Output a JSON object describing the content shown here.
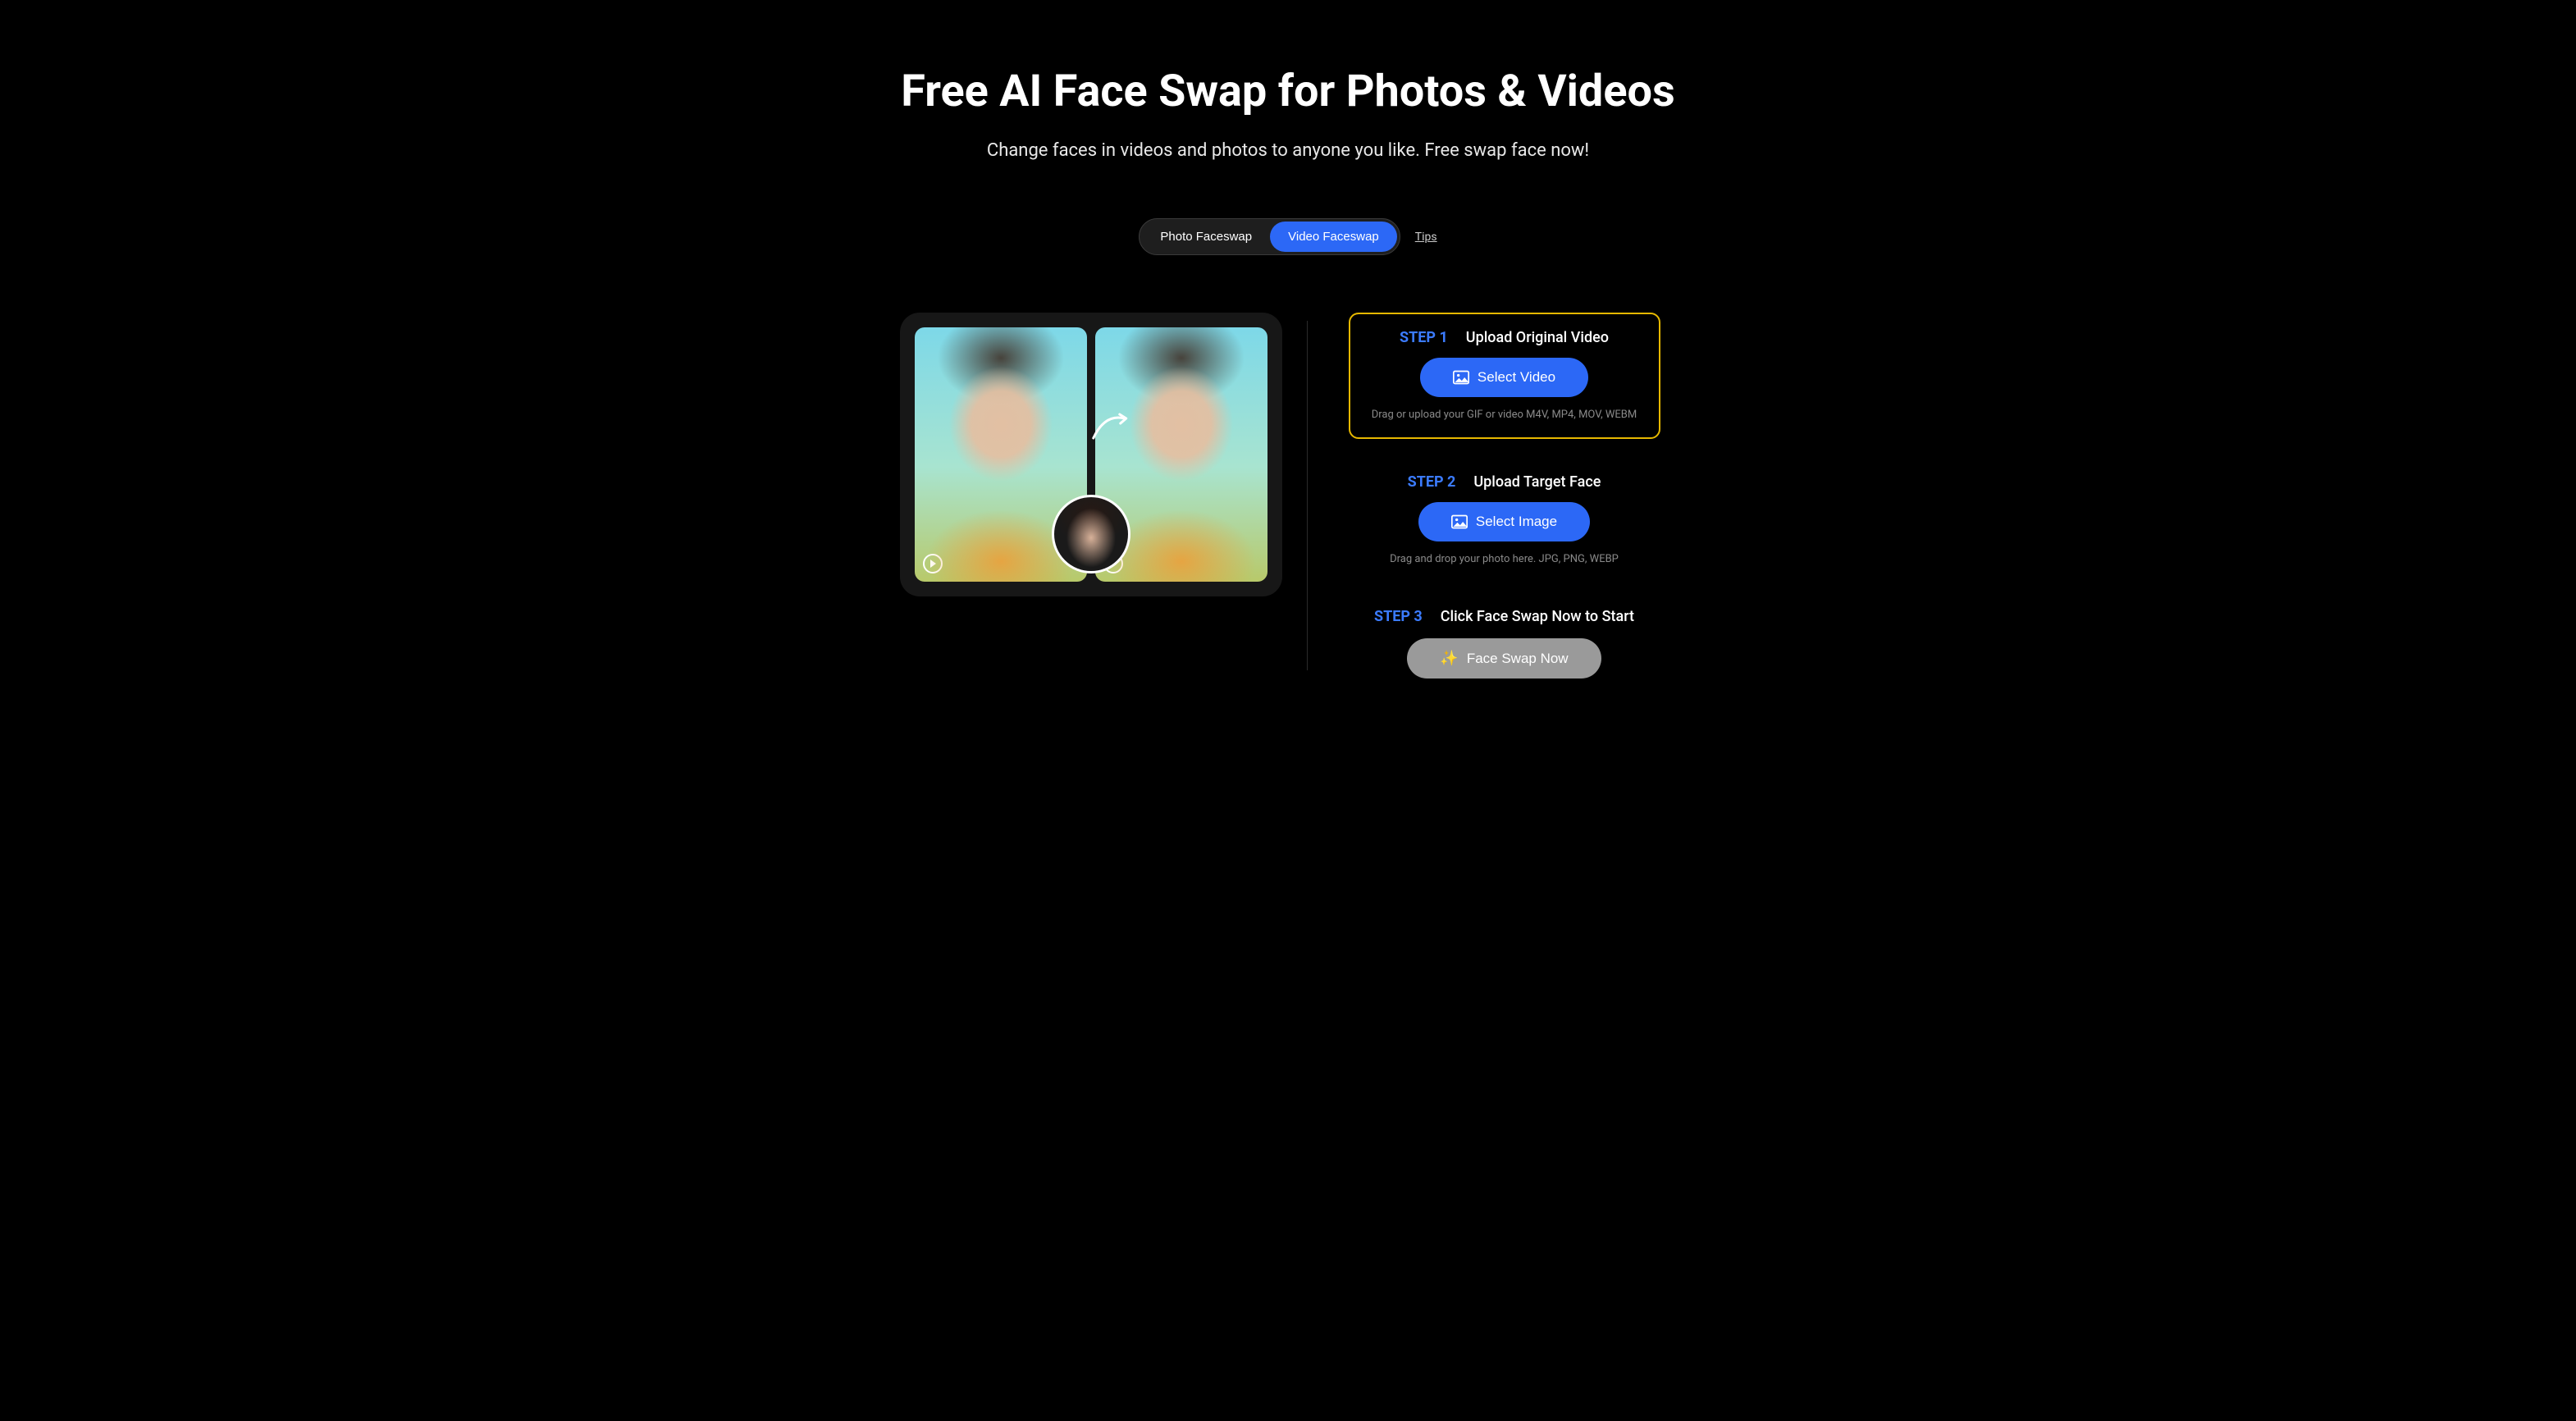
{
  "hero": {
    "title": "Free AI Face Swap for Photos & Videos",
    "subtitle": "Change faces in videos and photos to anyone you like. Free swap face now!"
  },
  "modes": {
    "photo": "Photo Faceswap",
    "video": "Video Faceswap",
    "tips": "Tips"
  },
  "steps": {
    "s1": {
      "num": "STEP 1",
      "title": "Upload Original Video",
      "button": "Select Video",
      "hint": "Drag or upload your GIF or video M4V, MP4, MOV, WEBM"
    },
    "s2": {
      "num": "STEP 2",
      "title": "Upload Target Face",
      "button": "Select Image",
      "hint": "Drag and drop your photo here. JPG, PNG, WEBP"
    },
    "s3": {
      "num": "STEP 3",
      "title": "Click Face Swap Now to Start",
      "button": "Face Swap Now"
    }
  }
}
